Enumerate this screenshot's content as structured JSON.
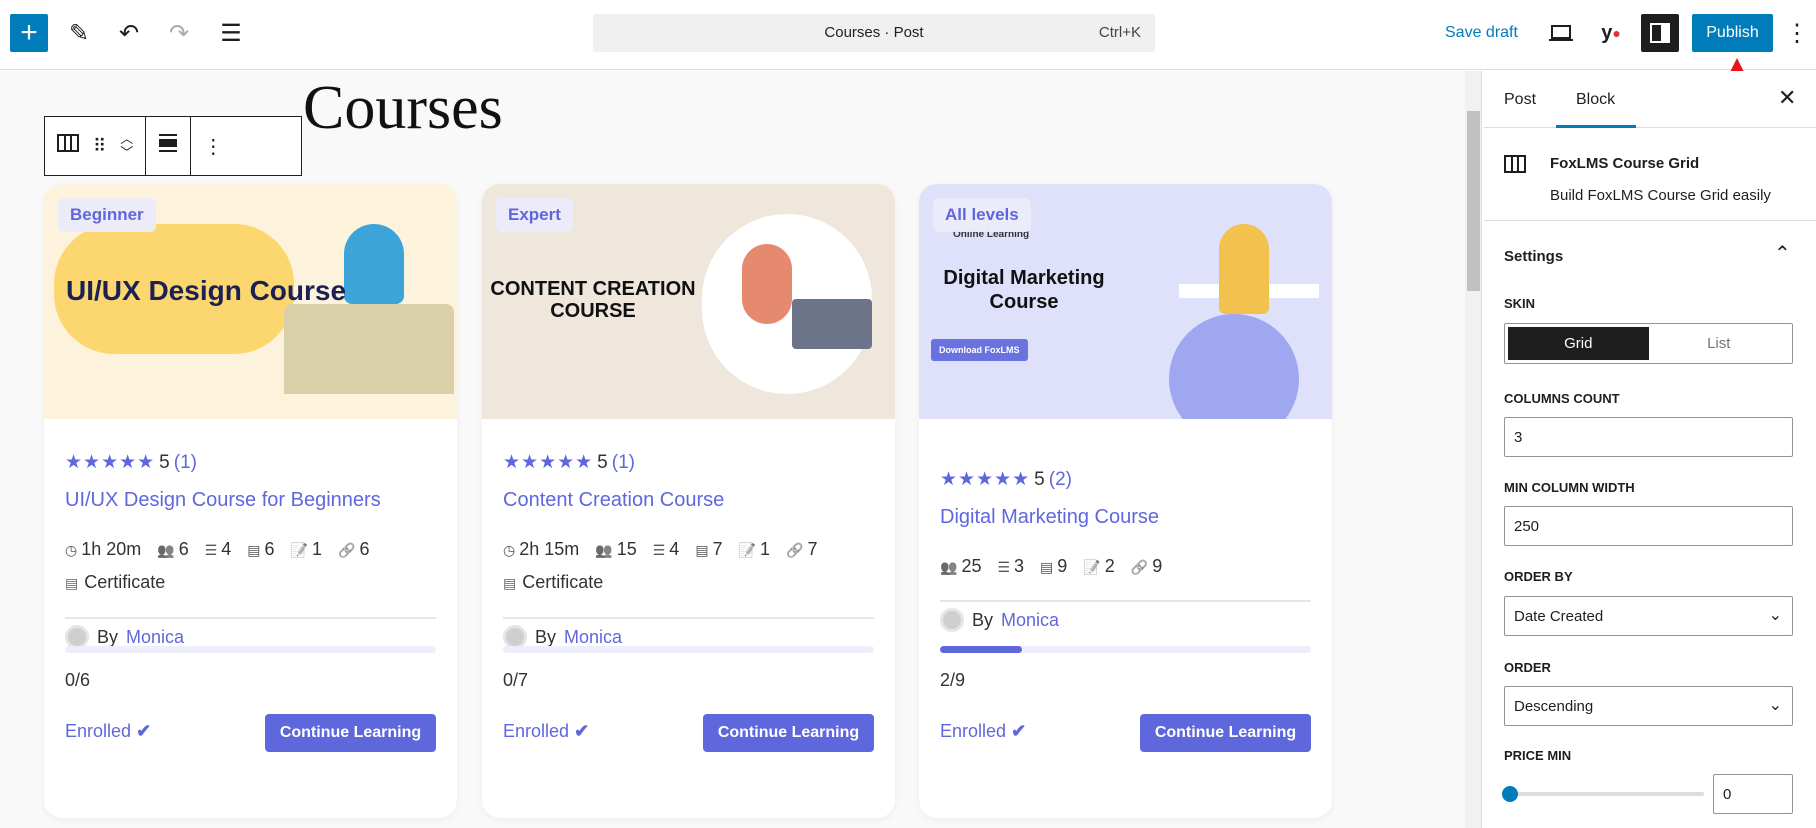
{
  "topbar": {
    "document_title": "Courses · Post",
    "shortcut": "Ctrl+K",
    "save_draft": "Save draft",
    "publish": "Publish"
  },
  "editor": {
    "heading": "Courses"
  },
  "colors": {
    "accent": "#5f67dc",
    "wp_blue": "#007cba",
    "annotation_arrow": "#e8141b"
  },
  "cards": [
    {
      "badge": "Beginner",
      "image_text": "UI/UX Design Course",
      "rating": "5",
      "reviews": "(1)",
      "title": "UI/UX Design Course for Beginners",
      "duration": "1h 20m",
      "students": "6",
      "sections": "4",
      "lessons": "6",
      "quizzes": "1",
      "assignments": "6",
      "certificate": "Certificate",
      "by": "By",
      "author": "Monica",
      "progress": "0/6",
      "progress_fraction": 0,
      "enrolled": "Enrolled",
      "button": "Continue Learning"
    },
    {
      "badge": "Expert",
      "image_text": "CONTENT CREATION COURSE",
      "rating": "5",
      "reviews": "(1)",
      "title": "Content Creation Course",
      "duration": "2h 15m",
      "students": "15",
      "sections": "4",
      "lessons": "7",
      "quizzes": "1",
      "assignments": "7",
      "certificate": "Certificate",
      "by": "By",
      "author": "Monica",
      "progress": "0/7",
      "progress_fraction": 0,
      "enrolled": "Enrolled",
      "button": "Continue Learning"
    },
    {
      "badge": "All levels",
      "image_text": "Digital Marketing Course",
      "image_subtext": "Online Learning",
      "image_button": "Download FoxLMS",
      "rating": "5",
      "reviews": "(2)",
      "title": "Digital Marketing Course",
      "students": "25",
      "sections": "3",
      "lessons": "9",
      "quizzes": "2",
      "assignments": "9",
      "by": "By",
      "author": "Monica",
      "progress": "2/9",
      "progress_fraction": 0.222,
      "enrolled": "Enrolled",
      "button": "Continue Learning"
    }
  ],
  "sidebar": {
    "tabs": [
      "Post",
      "Block"
    ],
    "active_tab": "Block",
    "block_name": "FoxLMS Course Grid",
    "block_desc": "Build FoxLMS Course Grid easily",
    "settings_title": "Settings",
    "skin_label": "SKIN",
    "skin_options": [
      "Grid",
      "List"
    ],
    "skin_selected": "Grid",
    "columns_label": "COLUMNS COUNT",
    "columns_value": "3",
    "min_width_label": "MIN COLUMN WIDTH",
    "min_width_value": "250",
    "order_by_label": "ORDER BY",
    "order_by_value": "Date Created",
    "order_label": "ORDER",
    "order_value": "Descending",
    "price_min_label": "PRICE MIN",
    "price_min_value": "0",
    "price_min_slider": 0
  }
}
